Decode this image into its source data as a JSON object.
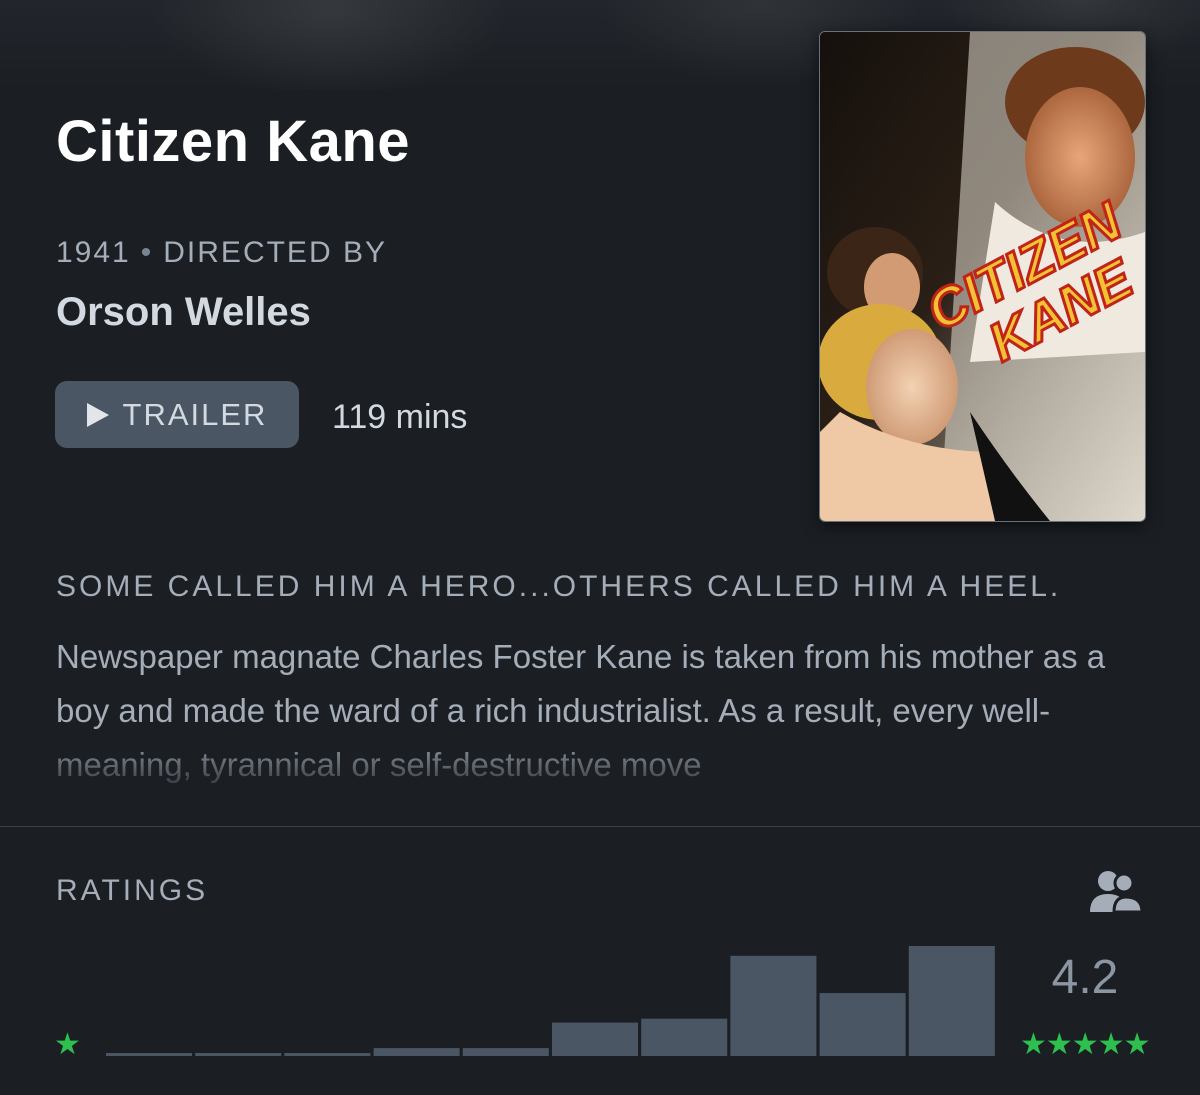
{
  "film": {
    "title": "Citizen Kane",
    "year": "1941",
    "directed_by_label": "DIRECTED BY",
    "director": "Orson Welles",
    "runtime": "119 mins",
    "poster_title_text": "CITIZEN KANE"
  },
  "actions": {
    "trailer_label": "TRAILER"
  },
  "tagline": "SOME CALLED HIM A HERO...OTHERS CALLED HIM A HEEL.",
  "synopsis": "Newspaper magnate Charles Foster Kane is taken from his mother as a boy and made the ward of a rich industrialist. As a result, every well-meaning, tyrannical or self-destructive move",
  "ratings": {
    "label": "RATINGS",
    "average": "4.2",
    "low_star": "★",
    "high_stars": "★★★★★",
    "icons": {
      "friends": "friends-icon",
      "play": "play-icon"
    }
  },
  "chart_data": {
    "type": "bar",
    "categories": [
      "0.5",
      "1",
      "1.5",
      "2",
      "2.5",
      "3",
      "3.5",
      "4",
      "4.5",
      "5"
    ],
    "values": [
      1,
      1,
      1,
      4,
      4,
      17,
      19,
      51,
      32,
      56
    ],
    "title": "",
    "xlabel": "",
    "ylabel": "",
    "ylim": [
      0,
      56
    ],
    "grid": false,
    "legend": "none"
  },
  "colors": {
    "background": "#1b1f24",
    "bar": "#4b5664",
    "accent_green": "#2ec04f",
    "muted_text": "#a4adb8"
  }
}
